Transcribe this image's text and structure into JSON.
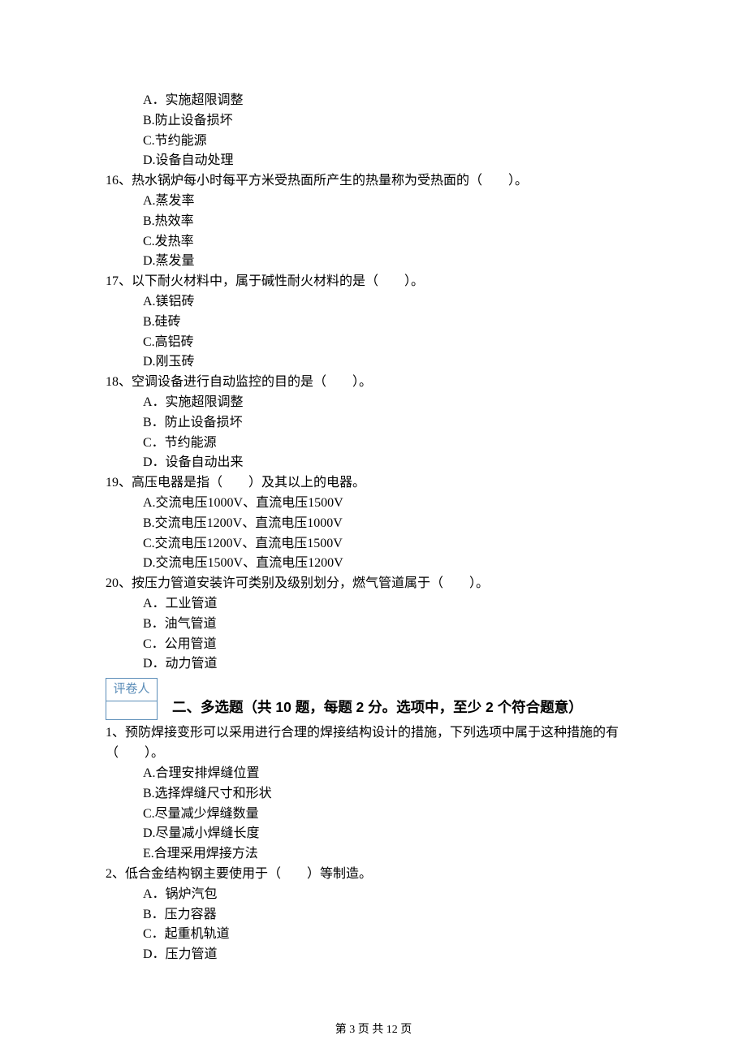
{
  "orphan_options": [
    "A．实施超限调整",
    "B.防止设备损坏",
    "C.节约能源",
    "D.设备自动处理"
  ],
  "single_choice": [
    {
      "num": "16",
      "stem": "热水锅炉每小时每平方米受热面所产生的热量称为受热面的（　　）。",
      "opts": [
        "A.蒸发率",
        "B.热效率",
        "C.发热率",
        "D.蒸发量"
      ]
    },
    {
      "num": "17",
      "stem": "以下耐火材料中，属于碱性耐火材料的是（　　）。",
      "opts": [
        "A.镁铝砖",
        "B.硅砖",
        "C.高铝砖",
        "D.刚玉砖"
      ]
    },
    {
      "num": "18",
      "stem": "空调设备进行自动监控的目的是（　　）。",
      "opts": [
        "A．实施超限调整",
        "B．防止设备损坏",
        "C．节约能源",
        "D．设备自动出来"
      ]
    },
    {
      "num": "19",
      "stem": "高压电器是指（　　）及其以上的电器。",
      "opts": [
        "A.交流电压1000V、直流电压1500V",
        "B.交流电压1200V、直流电压1000V",
        "C.交流电压1200V、直流电压1500V",
        "D.交流电压1500V、直流电压1200V"
      ]
    },
    {
      "num": "20",
      "stem": "按压力管道安装许可类别及级别划分，燃气管道属于（　　）。",
      "opts": [
        "A．工业管道",
        "B．油气管道",
        "C．公用管道",
        "D．动力管道"
      ]
    }
  ],
  "grader_label": "评卷人",
  "section2_title": "二、多选题（共 10 题，每题 2 分。选项中，至少 2 个符合题意）",
  "multi_choice": [
    {
      "num": "1",
      "stem": "预防焊接变形可以采用进行合理的焊接结构设计的措施，下列选项中属于这种措施的有（　　）。",
      "opts": [
        "A.合理安排焊缝位置",
        "B.选择焊缝尺寸和形状",
        "C.尽量减少焊缝数量",
        "D.尽量减小焊缝长度",
        "E.合理采用焊接方法"
      ]
    },
    {
      "num": "2",
      "stem": "低合金结构钢主要使用于（　　）等制造。",
      "opts": [
        "A．锅炉汽包",
        "B．压力容器",
        "C．起重机轨道",
        "D．压力管道"
      ]
    }
  ],
  "footer": "第 3 页 共 12 页"
}
